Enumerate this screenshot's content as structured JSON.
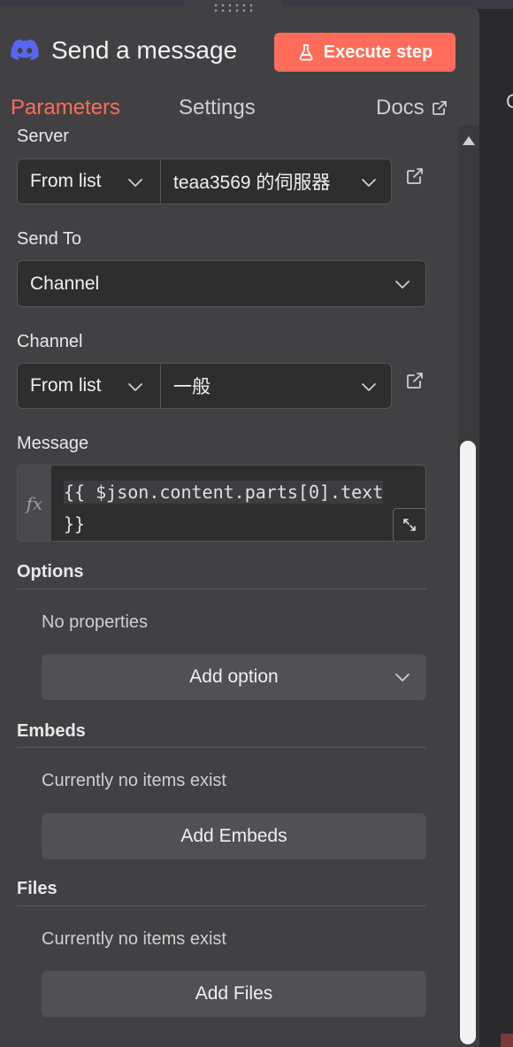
{
  "colors": {
    "accent": "#ff6d5a",
    "discord": "#5865f2"
  },
  "header": {
    "title": "Send a message",
    "execute_label": "Execute step"
  },
  "tabs": {
    "parameters": "Parameters",
    "settings": "Settings",
    "docs": "Docs"
  },
  "fields": {
    "server": {
      "label": "Server",
      "mode": "From list",
      "value": "teaa3569 的伺服器"
    },
    "send_to": {
      "label": "Send To",
      "value": "Channel"
    },
    "channel": {
      "label": "Channel",
      "mode": "From list",
      "value": "一般"
    },
    "message": {
      "label": "Message",
      "fx": "fx",
      "expr_line1": "{{ $json.content.parts[0].text ",
      "expr_line2": "}}"
    }
  },
  "options": {
    "label": "Options",
    "empty": "No properties",
    "add": "Add option"
  },
  "embeds": {
    "label": "Embeds",
    "empty": "Currently no items exist",
    "add": "Add Embeds"
  },
  "files": {
    "label": "Files",
    "empty": "Currently no items exist",
    "add": "Add Files"
  },
  "background": {
    "letter": "C"
  }
}
